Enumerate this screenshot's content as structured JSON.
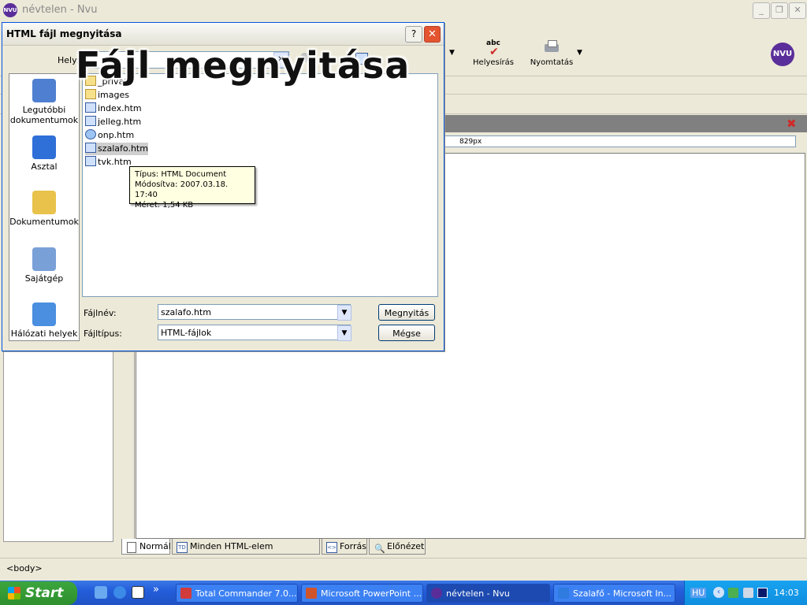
{
  "window": {
    "title": "névtelen - Nvu",
    "minimize": "_",
    "restore": "❐",
    "close": "✕"
  },
  "toolbar": {
    "spell_label": "Helyesírás",
    "print_label": "Nyomtatás",
    "spell_icon_text": "abc"
  },
  "ruler": {
    "width_value": "829px"
  },
  "editor_tabs": [
    {
      "label": "Normál",
      "icon": "page-icon"
    },
    {
      "label": "Minden HTML-elem megjelenítése",
      "icon": "TD"
    },
    {
      "label": "Forrás",
      "icon": "<>"
    },
    {
      "label": "Előnézet",
      "icon": "magnifier-icon"
    }
  ],
  "statusbar": {
    "text": "<body>"
  },
  "dialog": {
    "title": "HTML fájl megnyitása",
    "help": "?",
    "close": "✕",
    "location_label": "Hely:",
    "places": [
      {
        "label": "Legutóbbi dokumentumok",
        "icon": "recent-documents-icon",
        "color": "#4f7fd0"
      },
      {
        "label": "Asztal",
        "icon": "desktop-icon",
        "color": "#2f6fd8"
      },
      {
        "label": "Dokumentumok",
        "icon": "my-documents-icon",
        "color": "#e8c24a"
      },
      {
        "label": "Sajátgép",
        "icon": "my-computer-icon",
        "color": "#7aa0d8"
      },
      {
        "label": "Hálózati helyek",
        "icon": "network-places-icon",
        "color": "#4a8fe0"
      }
    ],
    "files": [
      {
        "name": "_private",
        "type": "folder"
      },
      {
        "name": "images",
        "type": "folder"
      },
      {
        "name": "index.htm",
        "type": "html"
      },
      {
        "name": "jelleg.htm",
        "type": "html"
      },
      {
        "name": "onp.htm",
        "type": "ie"
      },
      {
        "name": "szalafo.htm",
        "type": "html",
        "selected": true
      },
      {
        "name": "tvk.htm",
        "type": "html"
      }
    ],
    "tooltip": {
      "type_line": "Típus: HTML Document",
      "modified_line": "Módosítva: 2007.03.18. 17:40",
      "size_line": "Méret: 1,54 KB"
    },
    "filename_label": "Fájlnév:",
    "filename_value": "szalafo.htm",
    "filetype_label": "Fájltípus:",
    "filetype_value": "HTML-fájlok",
    "open_button": "Megnyitás",
    "cancel_button": "Mégse"
  },
  "overlay_caption": "Fájl megnyitása",
  "taskbar": {
    "start": "Start",
    "quicklaunch_more": "»",
    "tasks": [
      {
        "label": "Total Commander 7.0...",
        "active": false,
        "color": "#d23b3b"
      },
      {
        "label": "Microsoft PowerPoint ...",
        "active": false,
        "color": "#d0542a"
      },
      {
        "label": "névtelen - Nvu",
        "active": true,
        "color": "#5a2e9a"
      },
      {
        "label": "Szalafő - Microsoft In...",
        "active": false,
        "color": "#2f7be0"
      }
    ],
    "language": "HU",
    "clock": "14:03"
  },
  "colors": {
    "xp_blue": "#245edb",
    "nvu_purple": "#5a2e9a",
    "tooltip_bg": "#ffffe1",
    "close_red": "#e3542f"
  }
}
